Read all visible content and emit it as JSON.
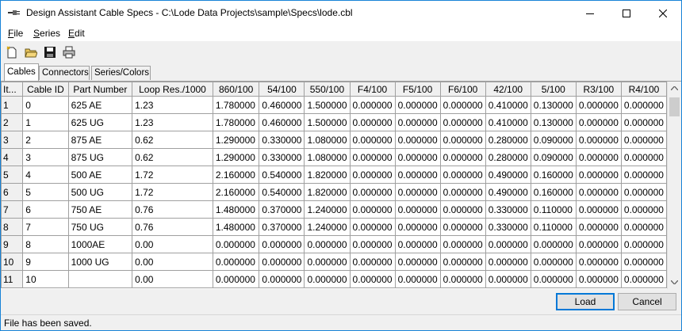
{
  "window": {
    "title": "Design Assistant Cable Specs - C:\\Lode Data Projects\\sample\\Specs\\lode.cbl",
    "min_glyph": "─",
    "max_glyph": "☐",
    "close_glyph": "✕"
  },
  "menu": [
    {
      "key": "F",
      "rest": "ile"
    },
    {
      "key": "S",
      "rest": "eries"
    },
    {
      "key": "E",
      "rest": "dit"
    }
  ],
  "toolbar": [
    "new-file-icon",
    "open-folder-icon",
    "save-disk-icon",
    "print-icon"
  ],
  "tabs": [
    {
      "label": "Cables",
      "active": true
    },
    {
      "label": "Connectors",
      "active": false
    },
    {
      "label": "Series/Colors",
      "active": false
    }
  ],
  "table": {
    "columns": [
      "It...",
      "Cable ID",
      "Part Number",
      "Loop Res./1000",
      "860/100",
      "54/100",
      "550/100",
      "F4/100",
      "F5/100",
      "F6/100",
      "42/100",
      "5/100",
      "R3/100",
      "R4/100"
    ],
    "rows": [
      [
        "1",
        "0",
        "625 AE",
        "1.23",
        "1.780000",
        "0.460000",
        "1.500000",
        "0.000000",
        "0.000000",
        "0.000000",
        "0.410000",
        "0.130000",
        "0.000000",
        "0.000000"
      ],
      [
        "2",
        "1",
        "625 UG",
        "1.23",
        "1.780000",
        "0.460000",
        "1.500000",
        "0.000000",
        "0.000000",
        "0.000000",
        "0.410000",
        "0.130000",
        "0.000000",
        "0.000000"
      ],
      [
        "3",
        "2",
        "875 AE",
        "0.62",
        "1.290000",
        "0.330000",
        "1.080000",
        "0.000000",
        "0.000000",
        "0.000000",
        "0.280000",
        "0.090000",
        "0.000000",
        "0.000000"
      ],
      [
        "4",
        "3",
        "875 UG",
        "0.62",
        "1.290000",
        "0.330000",
        "1.080000",
        "0.000000",
        "0.000000",
        "0.000000",
        "0.280000",
        "0.090000",
        "0.000000",
        "0.000000"
      ],
      [
        "5",
        "4",
        "500 AE",
        "1.72",
        "2.160000",
        "0.540000",
        "1.820000",
        "0.000000",
        "0.000000",
        "0.000000",
        "0.490000",
        "0.160000",
        "0.000000",
        "0.000000"
      ],
      [
        "6",
        "5",
        "500 UG",
        "1.72",
        "2.160000",
        "0.540000",
        "1.820000",
        "0.000000",
        "0.000000",
        "0.000000",
        "0.490000",
        "0.160000",
        "0.000000",
        "0.000000"
      ],
      [
        "7",
        "6",
        "750 AE",
        "0.76",
        "1.480000",
        "0.370000",
        "1.240000",
        "0.000000",
        "0.000000",
        "0.000000",
        "0.330000",
        "0.110000",
        "0.000000",
        "0.000000"
      ],
      [
        "8",
        "7",
        "750 UG",
        "0.76",
        "1.480000",
        "0.370000",
        "1.240000",
        "0.000000",
        "0.000000",
        "0.000000",
        "0.330000",
        "0.110000",
        "0.000000",
        "0.000000"
      ],
      [
        "9",
        "8",
        "1000AE",
        "0.00",
        "0.000000",
        "0.000000",
        "0.000000",
        "0.000000",
        "0.000000",
        "0.000000",
        "0.000000",
        "0.000000",
        "0.000000",
        "0.000000"
      ],
      [
        "10",
        "9",
        "1000 UG",
        "0.00",
        "0.000000",
        "0.000000",
        "0.000000",
        "0.000000",
        "0.000000",
        "0.000000",
        "0.000000",
        "0.000000",
        "0.000000",
        "0.000000"
      ],
      [
        "11",
        "10",
        "",
        "0.00",
        "0.000000",
        "0.000000",
        "0.000000",
        "0.000000",
        "0.000000",
        "0.000000",
        "0.000000",
        "0.000000",
        "0.000000",
        "0.000000"
      ]
    ]
  },
  "buttons": {
    "load": "Load",
    "cancel": "Cancel"
  },
  "status": "File has been saved.",
  "colors": {
    "accent": "#0078d7",
    "window_border": "#1883d7",
    "grid_line": "#a0a0a0"
  }
}
